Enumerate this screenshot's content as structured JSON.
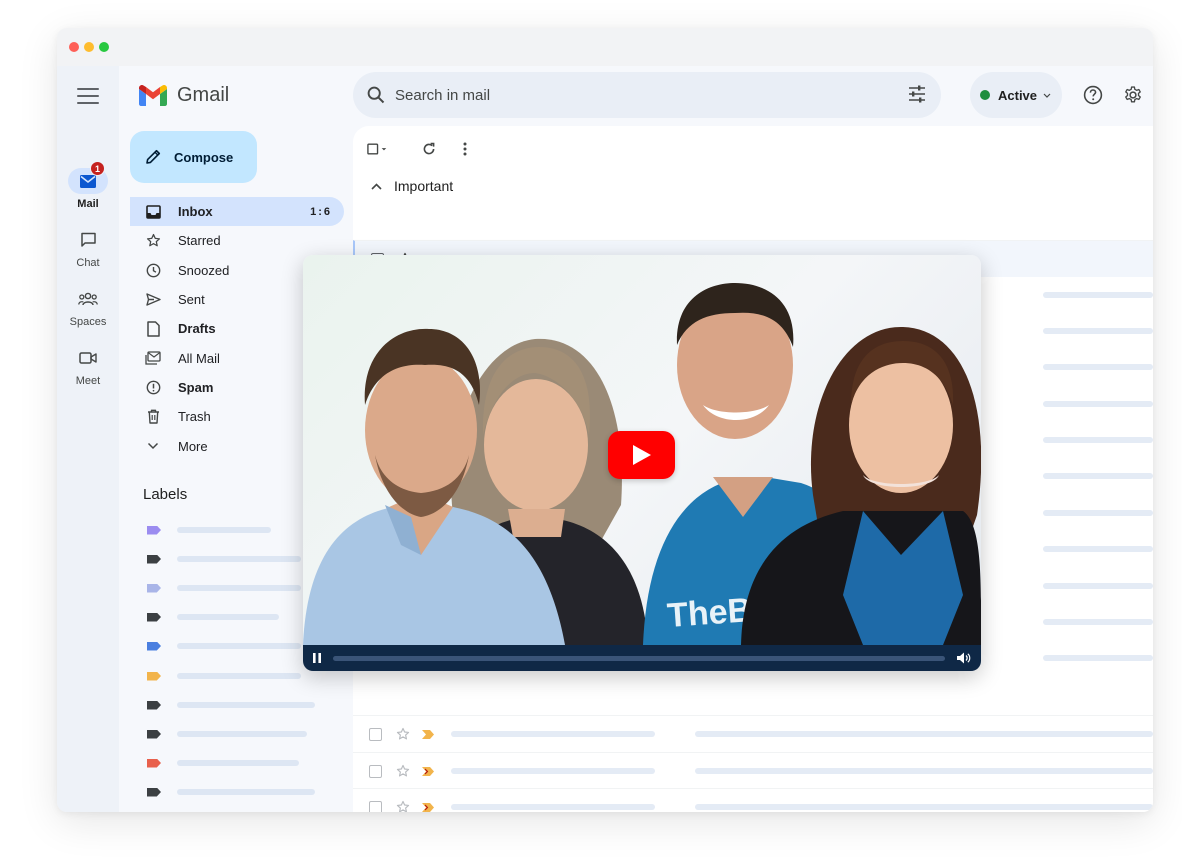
{
  "window": {
    "traffic_lights": [
      "close",
      "minimize",
      "zoom"
    ]
  },
  "rail": {
    "items": [
      {
        "label": "Mail",
        "icon": "mail-icon",
        "badge": "1",
        "active": true
      },
      {
        "label": "Chat",
        "icon": "chat-icon"
      },
      {
        "label": "Spaces",
        "icon": "spaces-icon"
      },
      {
        "label": "Meet",
        "icon": "meet-icon"
      }
    ]
  },
  "brand": {
    "name": "Gmail",
    "logo": "gmail-logo"
  },
  "compose": {
    "label": "Compose",
    "icon": "pencil-icon"
  },
  "nav": {
    "items": [
      {
        "label": "Inbox",
        "count": "1:6",
        "icon": "inbox-icon",
        "active": true
      },
      {
        "label": "Starred",
        "icon": "star-icon"
      },
      {
        "label": "Snoozed",
        "icon": "clock-icon"
      },
      {
        "label": "Sent",
        "icon": "send-icon"
      },
      {
        "label": "Drafts",
        "icon": "draft-icon",
        "bold": true
      },
      {
        "label": "All Mail",
        "icon": "all-mail-icon"
      },
      {
        "label": "Spam",
        "icon": "spam-icon",
        "bold": true
      },
      {
        "label": "Trash",
        "icon": "trash-icon"
      },
      {
        "label": "More",
        "icon": "chevron-down-icon"
      }
    ]
  },
  "labels": {
    "title": "Labels",
    "colors": [
      "#9b8cf0",
      "#3c4043",
      "#a9b5e8",
      "#3c4043",
      "#4a7fe0",
      "#f2b44b",
      "#3c4043",
      "#3c4043",
      "#e8604c",
      "#3c4043"
    ]
  },
  "search": {
    "placeholder": "Search in mail",
    "icon": "search-icon",
    "filter_icon": "tune-icon"
  },
  "status": {
    "label": "Active",
    "color": "#1e8e3e"
  },
  "topbar": {
    "help_icon": "help-icon",
    "settings_icon": "gear-icon"
  },
  "toolbar": {
    "select_icon": "checkbox-icon",
    "refresh_icon": "refresh-icon",
    "more_icon": "more-vert-icon"
  },
  "section": {
    "title": "Important"
  },
  "video": {
    "play_icon": "play-icon",
    "pause_icon": "pause-icon",
    "volume_icon": "volume-icon",
    "shirt_text": "TheBa"
  },
  "colors": {
    "accent": "#c2e7ff",
    "nav_active": "#d3e3fd",
    "badge": "#c5221f",
    "important": "#f2b44b",
    "play": "#ff0000"
  }
}
